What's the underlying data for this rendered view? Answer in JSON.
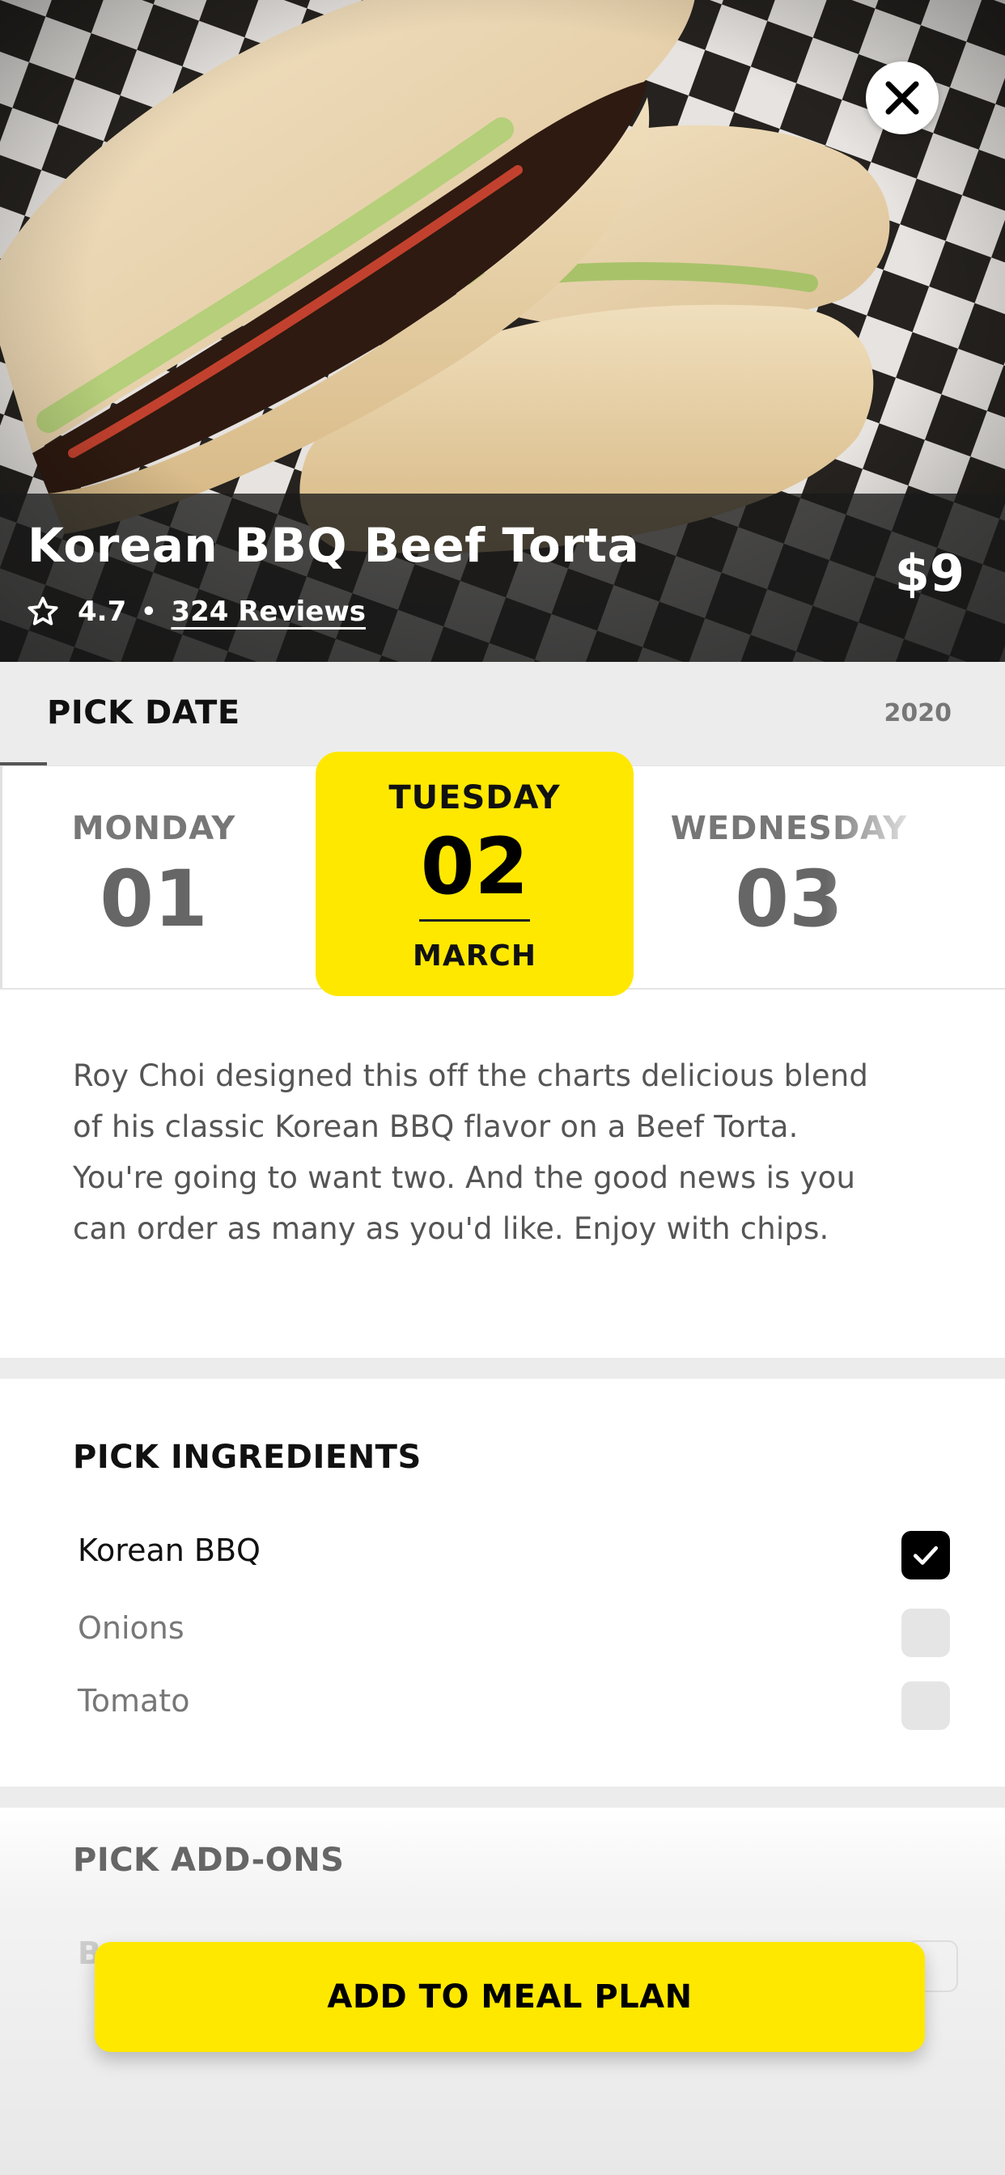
{
  "hero": {
    "title": "Korean BBQ Beef Torta",
    "price": "$9",
    "rating": "4.7",
    "separator": "•",
    "reviews": "324 Reviews",
    "image_subject": "Korean BBQ beef torta sandwich in a checkered paper-lined basket"
  },
  "date_picker": {
    "label": "PICK DATE",
    "year": "2020",
    "days": [
      {
        "weekday": "MONDAY",
        "date": "01"
      },
      {
        "weekday": "TUESDAY",
        "date": "02",
        "month": "MARCH",
        "selected": true
      },
      {
        "weekday": "WEDNESDAY",
        "date": "03"
      }
    ]
  },
  "description": "Roy Choi designed this off the charts delicious blend of his classic Korean BBQ flavor on a Beef Torta.   You're going to want two.  And the good news is you can order as many as you'd like.  Enjoy with chips.",
  "ingredients": {
    "title": "PICK INGREDIENTS",
    "items": [
      {
        "name": "Korean BBQ",
        "checked": true
      },
      {
        "name": "Onions",
        "checked": false
      },
      {
        "name": "Tomato",
        "checked": false
      }
    ]
  },
  "addons": {
    "title": "PICK ADD-ONS",
    "partial_item_initial": "B"
  },
  "cta": {
    "label": "ADD TO MEAL PLAN"
  },
  "colors": {
    "accent_yellow": "#ffe800",
    "section_gray": "#ececec",
    "hero_overlay": "#191919"
  },
  "icons": {
    "close": "close-icon",
    "rating": "star-outline-icon",
    "checked": "checkmark-icon"
  }
}
